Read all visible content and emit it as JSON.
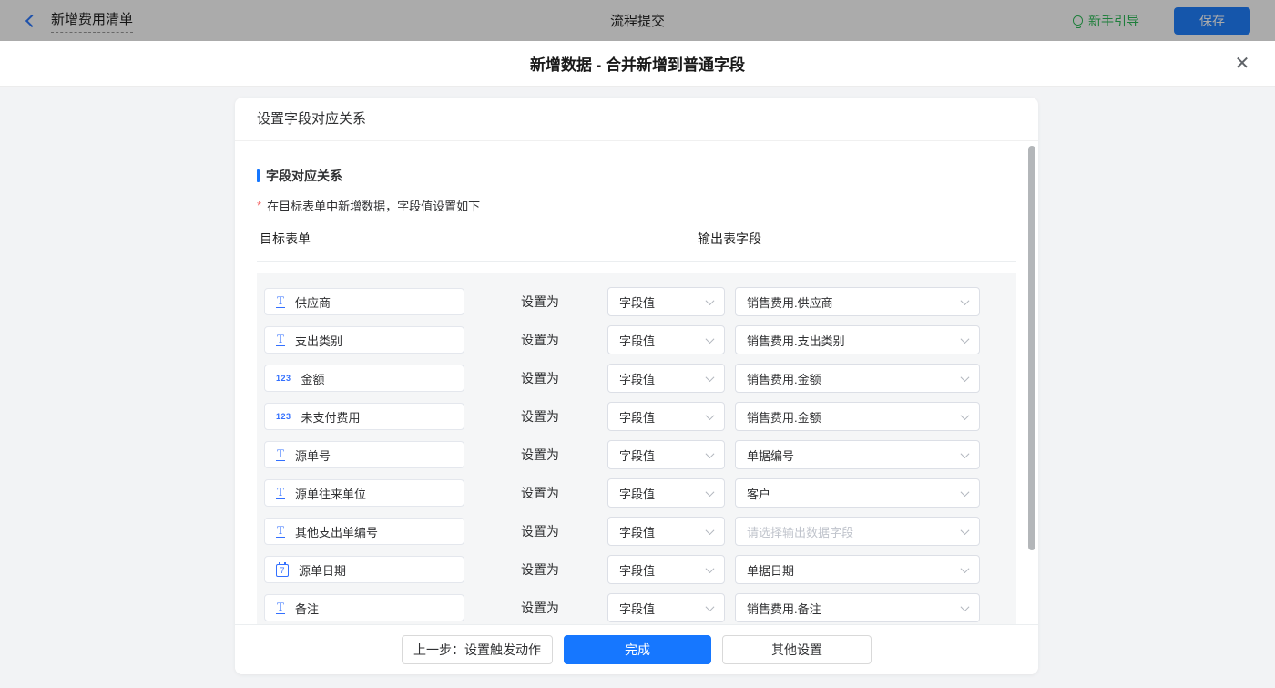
{
  "topbar": {
    "back_label": "新增费用清单",
    "center_title": "流程提交",
    "guide_label": "新手引导",
    "save_label": "保存"
  },
  "modal": {
    "title": "新增数据 - 合并新增到普通字段",
    "close_glyph": "✕"
  },
  "panel": {
    "header": "设置字段对应关系",
    "section_title": "字段对应关系",
    "required_mark": "*",
    "note": "在目标表单中新增数据，字段值设置如下",
    "columns": {
      "left": "目标表单",
      "right": "输出表字段"
    },
    "set_as_label": "设置为",
    "rows": [
      {
        "icon": "text",
        "field": "供应商",
        "mode": "字段值",
        "output": "销售费用.供应商",
        "output_placeholder": false
      },
      {
        "icon": "text",
        "field": "支出类别",
        "mode": "字段值",
        "output": "销售费用.支出类别",
        "output_placeholder": false
      },
      {
        "icon": "number",
        "field": "金额",
        "mode": "字段值",
        "output": "销售费用.金额",
        "output_placeholder": false
      },
      {
        "icon": "number",
        "field": "未支付费用",
        "mode": "字段值",
        "output": "销售费用.金额",
        "output_placeholder": false
      },
      {
        "icon": "text",
        "field": "源单号",
        "mode": "字段值",
        "output": "单据编号",
        "output_placeholder": false
      },
      {
        "icon": "text",
        "field": "源单往来单位",
        "mode": "字段值",
        "output": "客户",
        "output_placeholder": false
      },
      {
        "icon": "text",
        "field": "其他支出单编号",
        "mode": "字段值",
        "output": "请选择输出数据字段",
        "output_placeholder": true
      },
      {
        "icon": "date",
        "field": "源单日期",
        "mode": "字段值",
        "output": "单据日期",
        "output_placeholder": false
      },
      {
        "icon": "text",
        "field": "备注",
        "mode": "字段值",
        "output": "销售费用.备注",
        "output_placeholder": false
      }
    ],
    "footer": {
      "prev_label": "上一步：设置触发动作",
      "done_label": "完成",
      "other_label": "其他设置"
    }
  },
  "colors": {
    "accent_blue": "#1677ff",
    "guide_green": "#2ebd59",
    "required_red": "#f56c6c"
  }
}
